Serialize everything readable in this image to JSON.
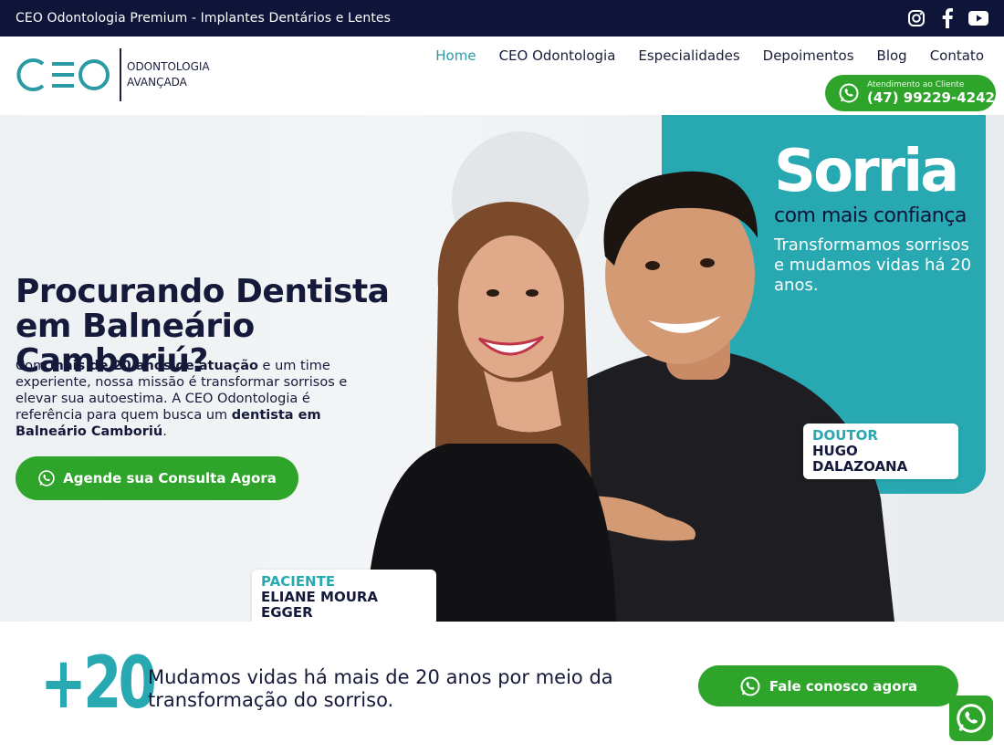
{
  "topbar": {
    "title": "CEO Odontologia Premium - Implantes Dentários e Lentes",
    "social": [
      "instagram-icon",
      "facebook-icon",
      "youtube-icon"
    ]
  },
  "logo": {
    "mark": "CEO",
    "line1": "ODONTOLOGIA",
    "line2": "AVANÇADA"
  },
  "nav": {
    "items": [
      {
        "label": "Home",
        "active": true
      },
      {
        "label": "CEO Odontologia",
        "active": false
      },
      {
        "label": "Especialidades",
        "active": false
      },
      {
        "label": "Depoimentos",
        "active": false
      },
      {
        "label": "Blog",
        "active": false
      },
      {
        "label": "Contato",
        "active": false
      }
    ]
  },
  "header_cta": {
    "small": "Atendimento ao Cliente",
    "phone": "(47) 99229-4242"
  },
  "hero": {
    "title": "Procurando Dentista em Balneário Camboriú?",
    "desc_parts": {
      "p1": "Com ",
      "b1": "mais de 20 anos de atuação",
      "p2": " e um time experiente, nossa missão é transformar sorrisos e elevar sua autoestima. A CEO Odontologia é referência para quem busca um ",
      "b2": "dentista em Balneário Camboriú",
      "p3": "."
    },
    "button": "Agende sua Consulta Agora"
  },
  "banner": {
    "headline": "Sorria",
    "subheadline": "com mais confiança",
    "text": "Transformamos sorrisos e mudamos vidas há 20 anos.",
    "doctor_role": "DOUTOR",
    "doctor_name": "HUGO DALAZOANA",
    "patient_role": "PACIENTE",
    "patient_name": "ELIANE MOURA EGGER"
  },
  "stats": {
    "number": "+20",
    "text": "Mudamos vidas há mais de 20 anos por meio da transformação do sorriso.",
    "button": "Fale conosco agora"
  },
  "colors": {
    "navy": "#0f1538",
    "teal": "#28a9b1",
    "green": "#2ea52a"
  }
}
